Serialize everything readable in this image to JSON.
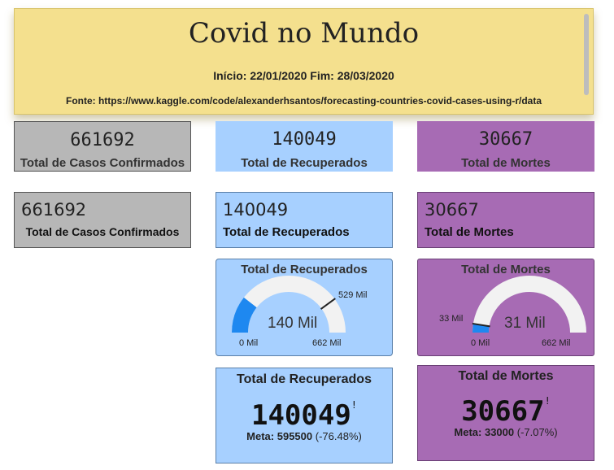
{
  "header": {
    "title": "Covid no Mundo",
    "dates": "Início:  22/01/2020  Fim: 28/03/2020",
    "source": "Fonte: https://www.kaggle.com/code/alexanderhsantos/forecasting-countries-covid-cases-using-r/data"
  },
  "colors": {
    "banner": "#f4e08e",
    "gray": "#b7b7b7",
    "blue": "#a7d0ff",
    "purple": "#a76bb4",
    "gauge_fill": "#1e88f0"
  },
  "row1": {
    "confirmed": {
      "value": "661692",
      "label": "Total de Casos Confirmados"
    },
    "recovered": {
      "value": "140049",
      "label": "Total de Recuperados"
    },
    "deaths": {
      "value": "30667",
      "label": "Total de Mortes"
    }
  },
  "row2": {
    "confirmed": {
      "value": "661692",
      "label": "Total de Casos Confirmados"
    },
    "recovered": {
      "value": "140049",
      "label": "Total de Recuperados"
    },
    "deaths": {
      "value": "30667",
      "label": "Total de Mortes"
    }
  },
  "gauge_recovered": {
    "title": "Total de Recuperados",
    "value_text": "140 Mil",
    "min_text": "0 Mil",
    "max_text": "662 Mil",
    "target_text": "529 Mil",
    "value": 140,
    "min": 0,
    "max": 662,
    "target": 529
  },
  "gauge_deaths": {
    "title": "Total de Mortes",
    "value_text": "31 Mil",
    "min_text": "0 Mil",
    "max_text": "662 Mil",
    "target_text": "33 Mil",
    "value": 31,
    "min": 0,
    "max": 662,
    "target": 33
  },
  "kpi_recovered": {
    "title": "Total de Recuperados",
    "value": "140049",
    "indicator": "!",
    "goal_label": "Meta:",
    "goal_value": "595500",
    "goal_diff": "(-76.48%)"
  },
  "kpi_deaths": {
    "title": "Total de Mortes",
    "value": "30667",
    "indicator": "!",
    "goal_label": "Meta:",
    "goal_value": "33000",
    "goal_diff": "(-7.07%)"
  }
}
